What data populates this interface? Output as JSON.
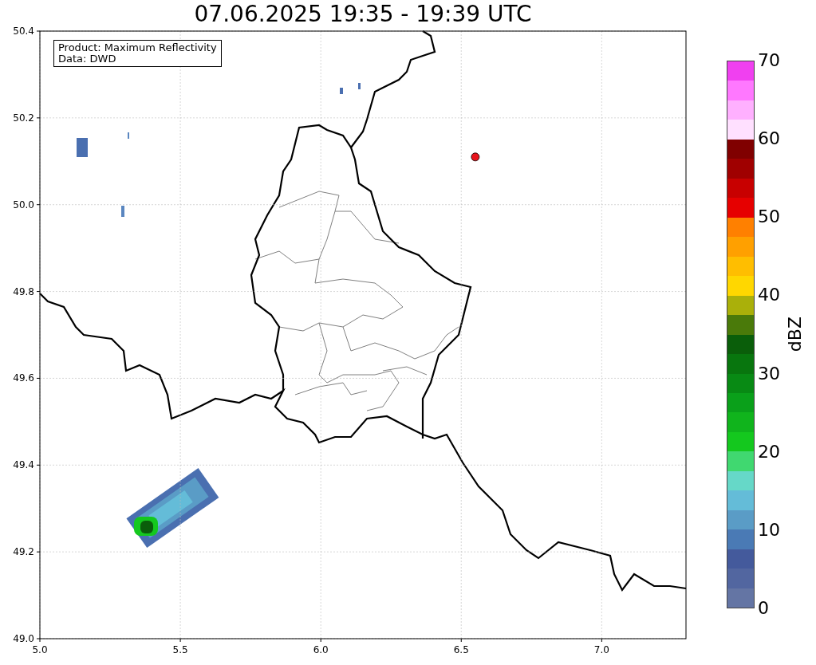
{
  "map": {
    "chart_data": {
      "type": "scatter",
      "title": "07.06.2025 19:35 - 19:39 UTC",
      "xlim": [
        5.0,
        7.3
      ],
      "ylim": [
        49.0,
        50.4
      ],
      "xticks": [
        {
          "value": 5.0,
          "label": "5.0"
        },
        {
          "value": 5.5,
          "label": "5.5"
        },
        {
          "value": 6.0,
          "label": "6.0"
        },
        {
          "value": 6.5,
          "label": "6.5"
        },
        {
          "value": 7.0,
          "label": "7.0"
        }
      ],
      "yticks": [
        {
          "value": 49.0,
          "label": "49.0"
        },
        {
          "value": 49.2,
          "label": "49.2"
        },
        {
          "value": 49.4,
          "label": "49.4"
        },
        {
          "value": 49.6,
          "label": "49.6"
        },
        {
          "value": 49.8,
          "label": "49.8"
        },
        {
          "value": 50.0,
          "label": "50.0"
        },
        {
          "value": 50.2,
          "label": "50.2"
        },
        {
          "value": 50.4,
          "label": "50.4"
        }
      ],
      "grid": true,
      "x": [
        6.55
      ],
      "series": [
        {
          "color": "#e8141c",
          "values": [
            50.11
          ]
        }
      ]
    },
    "legend": [
      "Product: Maximum Reflectivity",
      "Data: DWD"
    ]
  },
  "colorbar": {
    "label": "dBZ",
    "ticks": [
      "70",
      "60",
      "50",
      "40",
      "30",
      "20",
      "10",
      "0"
    ],
    "segments": [
      {
        "color": "#f040f0"
      },
      {
        "color": "#ff78ff"
      },
      {
        "color": "#ffb0ff"
      },
      {
        "color": "#ffe0ff"
      },
      {
        "color": "#800000"
      },
      {
        "color": "#a00000"
      },
      {
        "color": "#c80000"
      },
      {
        "color": "#e60000"
      },
      {
        "color": "#ff8000"
      },
      {
        "color": "#ffa000"
      },
      {
        "color": "#ffbe00"
      },
      {
        "color": "#ffd700"
      },
      {
        "color": "#aab00a"
      },
      {
        "color": "#4a7a0a"
      },
      {
        "color": "#0a5e0a"
      },
      {
        "color": "#08760e"
      },
      {
        "color": "#088a14"
      },
      {
        "color": "#0aa01a"
      },
      {
        "color": "#10b41c"
      },
      {
        "color": "#14c81e"
      },
      {
        "color": "#40d870"
      },
      {
        "color": "#66d8c8"
      },
      {
        "color": "#64bcd8"
      },
      {
        "color": "#5a9cc6"
      },
      {
        "color": "#4a7ab5"
      },
      {
        "color": "#445a9c"
      },
      {
        "color": "#5266a0"
      },
      {
        "color": "#6475a4"
      }
    ]
  }
}
